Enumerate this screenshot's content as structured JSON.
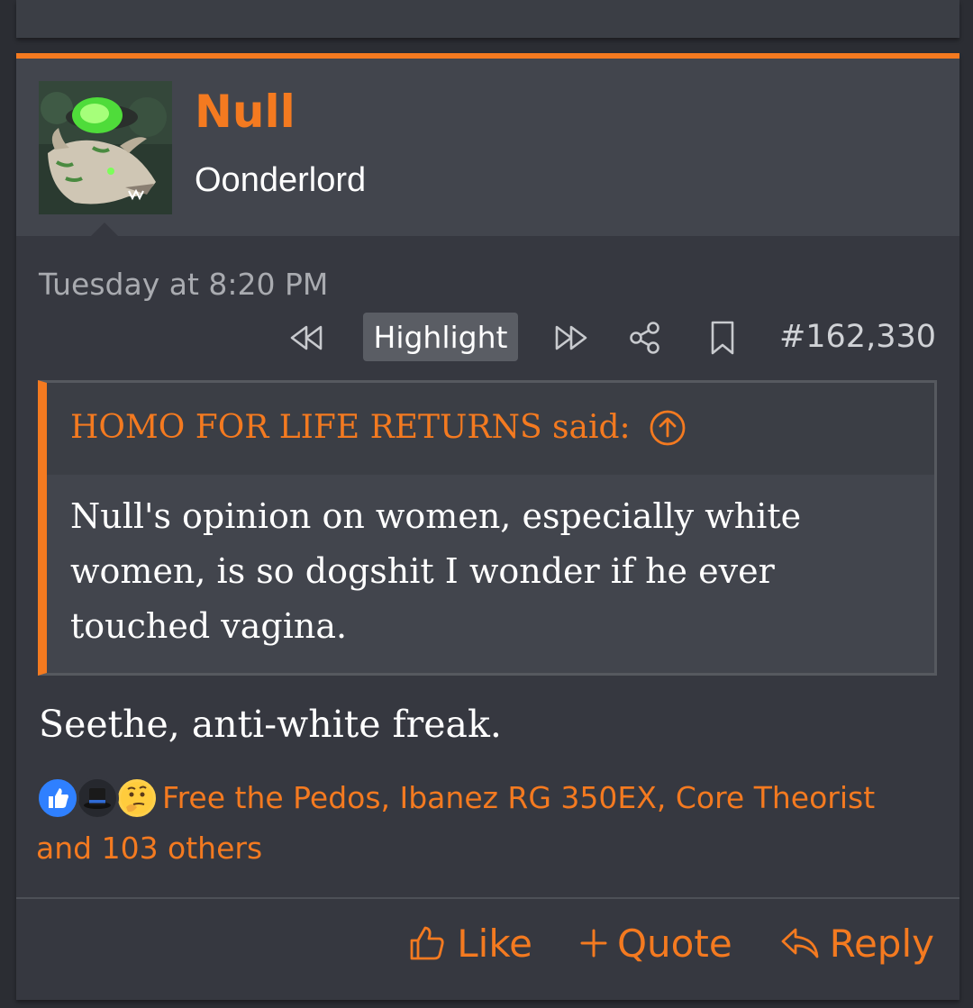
{
  "post": {
    "author": "Null",
    "user_title": "Oonderlord",
    "timestamp": "Tuesday at 8:20 PM",
    "highlight_label": "Highlight",
    "post_number": "#162,330",
    "icons": {
      "prev": "rewind-icon",
      "next": "fast-forward-icon",
      "share": "share-icon",
      "bookmark": "bookmark-icon"
    },
    "quote": {
      "author_said": "HOMO FOR LIFE RETURNS said:",
      "text": "Null's opinion on women, especially white women, is so dogshit I wonder if he ever touched vagina."
    },
    "body": "Seethe, anti-white freak.",
    "reactions": {
      "emoji": [
        "thumbs-up-icon",
        "top-hat-icon",
        "thinking-face-icon"
      ],
      "text": "Free the Pedos, Ibanez RG 350EX, Core Theorist and 103 others"
    },
    "footer": {
      "like": "Like",
      "quote": "Quote",
      "reply": "Reply"
    }
  },
  "colors": {
    "accent": "#f47a20",
    "background": "#2b2d33",
    "panel": "#363840",
    "header": "#42454d"
  }
}
